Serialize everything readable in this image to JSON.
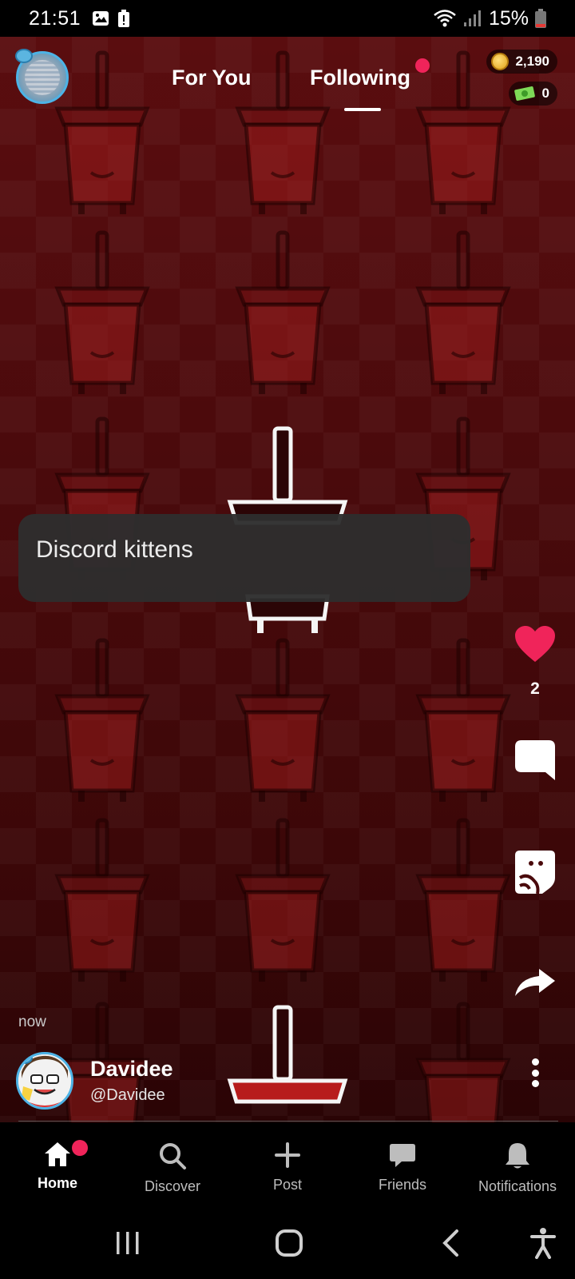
{
  "status_bar": {
    "time": "21:51",
    "battery": "15%"
  },
  "header": {
    "tabs": [
      {
        "label": "For You"
      },
      {
        "label": "Following"
      }
    ],
    "coins": "2,190",
    "cash": "0"
  },
  "post": {
    "caption": "Discord kittens",
    "likes": "2",
    "time": "now",
    "author_name": "Davidee",
    "author_handle": "@Davidee"
  },
  "bottom_nav": {
    "items": [
      {
        "label": "Home",
        "icon": "home-icon"
      },
      {
        "label": "Discover",
        "icon": "search-icon"
      },
      {
        "label": "Post",
        "icon": "plus-icon"
      },
      {
        "label": "Friends",
        "icon": "chat-icon"
      },
      {
        "label": "Notifications",
        "icon": "bell-icon"
      }
    ]
  },
  "colors": {
    "accent": "#f0245a",
    "background": "#4a0a0c",
    "avatar_ring": "#4db3e6"
  }
}
